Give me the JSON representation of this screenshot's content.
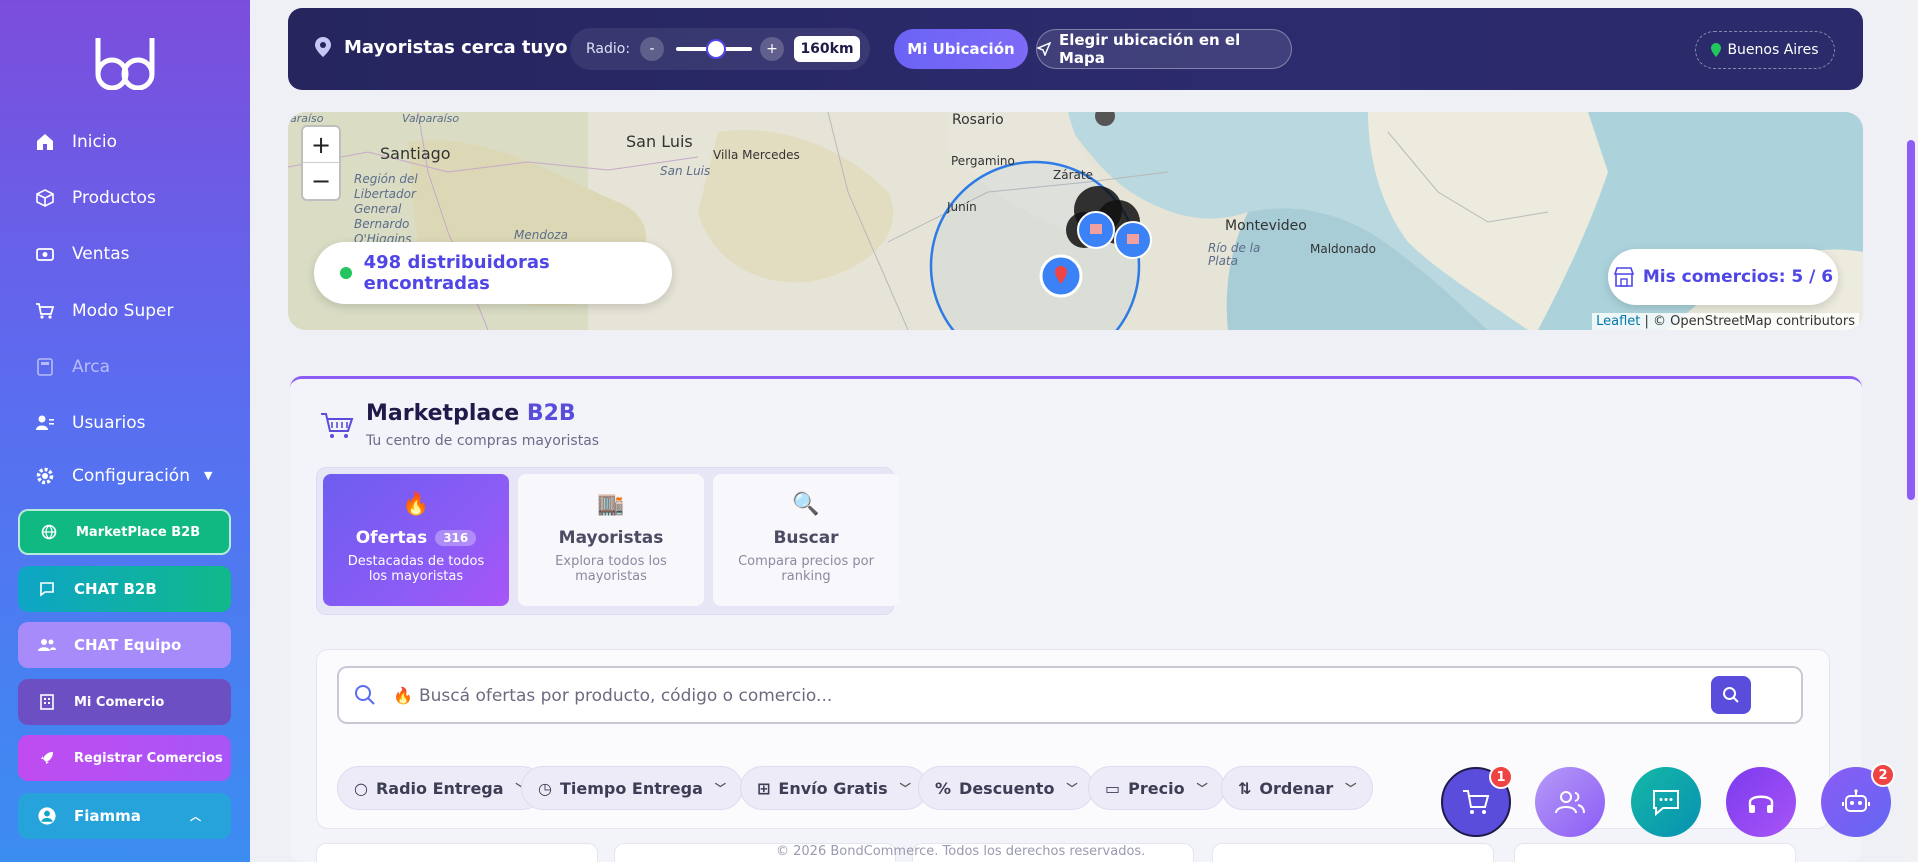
{
  "sidebar": {
    "logo_text": "bd",
    "items": [
      {
        "label": "Inicio",
        "icon": "home-icon"
      },
      {
        "label": "Productos",
        "icon": "box-icon"
      },
      {
        "label": "Ventas",
        "icon": "cash-icon"
      },
      {
        "label": "Modo Super",
        "icon": "cart-icon"
      },
      {
        "label": "Arca",
        "icon": "calculator-icon"
      },
      {
        "label": "Usuarios",
        "icon": "users-icon"
      },
      {
        "label": "Configuración",
        "icon": "gear-icon"
      }
    ],
    "pills": [
      {
        "label": "MarketPlace B2B",
        "color": "#10b981"
      },
      {
        "label": "CHAT B2B",
        "color": "#0ea5c6"
      },
      {
        "label": "CHAT Equipo",
        "color": "#a78bfa"
      },
      {
        "label": "Mi Comercio",
        "color": "#6d4fc4"
      },
      {
        "label": "Registrar Comercios",
        "color": "#c04cf0"
      }
    ],
    "user": "Fiamma"
  },
  "topbar": {
    "title": "Mayoristas cerca tuyo",
    "radius_label": "Radio:",
    "radius_minus": "-",
    "radius_plus": "+",
    "radius_value": "160km",
    "my_location": "Mi Ubicación",
    "choose_map": "Elegir ubicación en el Mapa",
    "city": "Buenos Aires"
  },
  "map": {
    "zoom_in": "+",
    "zoom_out": "−",
    "found": "498 distribuidoras encontradas",
    "my_stores": "Mis comercios: 5 / 6",
    "attribution_leaflet": "Leaflet",
    "attribution_rest": " | © OpenStreetMap contributors",
    "labels": {
      "rosario": "Rosario",
      "santiago": "Santiago",
      "sanluis": "San Luis",
      "sanluis2": "San Luis",
      "villamercedes": "Villa Mercedes",
      "pergamino": "Pergamino",
      "zarate": "Zárate",
      "junin": "Junín",
      "montevideo": "Montevideo",
      "maldonado": "Maldonado",
      "rioplata": "Río de la Plata",
      "mendoza": "Mendoza",
      "valparaiso": "Valparaíso",
      "paraiso": "araíso",
      "libertador": "Región del Libertador General Bernardo O'Higgins"
    }
  },
  "marketplace": {
    "title_a": "Marketplace",
    "title_b": "B2B",
    "subtitle": "Tu centro de compras mayoristas",
    "tabs": [
      {
        "label": "Ofertas",
        "badge": "316",
        "desc": "Destacadas de todos los mayoristas",
        "emoji": "🔥"
      },
      {
        "label": "Mayoristas",
        "desc": "Explora todos los mayoristas",
        "emoji": "🏬"
      },
      {
        "label": "Buscar",
        "desc": "Compara precios por ranking",
        "emoji": "🔍"
      }
    ],
    "search_placeholder": "Buscá ofertas por producto, código o comercio...",
    "filters": [
      "Radio Entrega",
      "Tiempo Entrega",
      "Envío Gratis",
      "Descuento",
      "Precio",
      "Ordenar"
    ],
    "footer": "© 2026 BondCommerce. Todos los derechos reservados."
  },
  "fabs": {
    "cart_count": "1",
    "bot_count": "2"
  }
}
